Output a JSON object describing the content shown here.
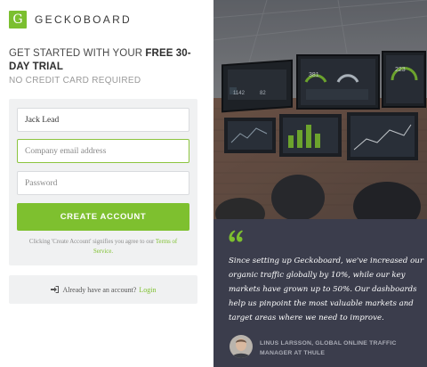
{
  "brand": {
    "logo_letter": "G",
    "name": "GECKOBOARD"
  },
  "headline": {
    "prefix": "GET STARTED WITH YOUR",
    "emphasis": "FREE 30-DAY TRIAL"
  },
  "subheadline": "NO CREDIT CARD REQUIRED",
  "signup_form": {
    "name_value": "Jack Lead",
    "email_placeholder": "Company email address",
    "password_placeholder": "Password",
    "submit_label": "CREATE ACCOUNT",
    "terms_prefix": "Clicking 'Create Account' signifies you agree to our",
    "terms_link": "Terms of Service."
  },
  "login": {
    "icon": "sign-in-icon",
    "prompt": "Already have an account?",
    "link": "Login"
  },
  "testimonial": {
    "quote": "Since setting up Geckoboard, we've increased our organic traffic globally by 10%, while our key markets have grown up to 50%. Our dashboards help us pinpoint the most valuable markets and target areas where we need to improve.",
    "author": "LINUS LARSSON, GLOBAL ONLINE TRAFFIC MANAGER AT THULE"
  },
  "photo_dashboard": {
    "gauge_values": [
      "381",
      "223"
    ]
  },
  "colors": {
    "accent": "#7ec02f",
    "panel": "#f0f1f2",
    "quote_bg": "#3b3d4c"
  }
}
